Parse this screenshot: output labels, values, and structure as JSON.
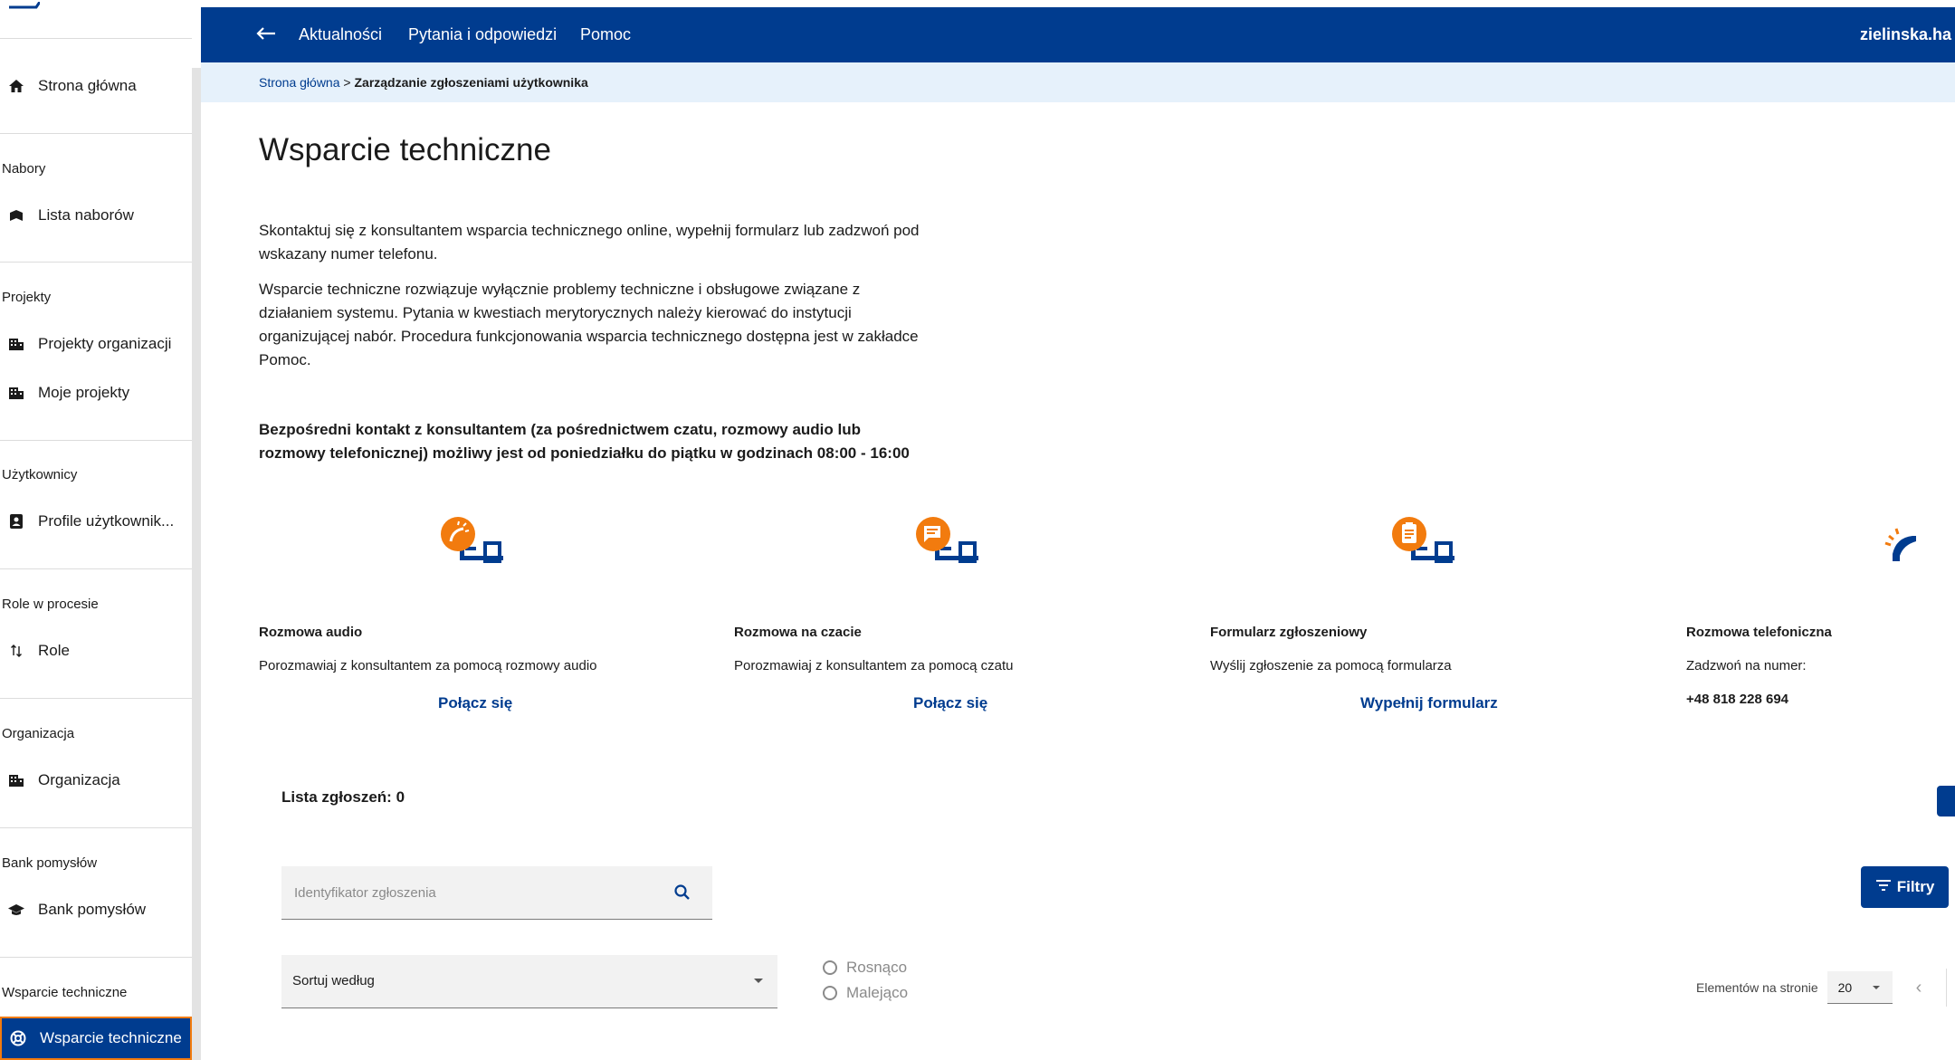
{
  "sidebar": {
    "items": [
      {
        "label": "Strona główna",
        "icon": "home-icon"
      },
      {
        "label": "Lista naborów",
        "icon": "books-icon"
      },
      {
        "label": "Projekty organizacji",
        "icon": "building-icon"
      },
      {
        "label": "Moje projekty",
        "icon": "building-icon"
      },
      {
        "label": "Profile użytkownik...",
        "icon": "contact-card-icon"
      },
      {
        "label": "Role",
        "icon": "sort-arrows-icon"
      },
      {
        "label": "Organizacja",
        "icon": "building-icon"
      },
      {
        "label": "Bank pomysłów",
        "icon": "graduation-cap-icon"
      },
      {
        "label": "Wsparcie techniczne",
        "icon": "lifebuoy-icon"
      }
    ],
    "sections": [
      "Nabory",
      "Projekty",
      "Użytkownicy",
      "Role w procesie",
      "Organizacja",
      "Bank pomysłów",
      "Wsparcie techniczne"
    ]
  },
  "topbar": {
    "nav": [
      "Aktualności",
      "Pytania i odpowiedzi",
      "Pomoc"
    ],
    "user": "zielinska.ha"
  },
  "breadcrumb": {
    "home": "Strona główna",
    "separator": ">",
    "current": "Zarządzanie zgłoszeniami użytkownika"
  },
  "page": {
    "title": "Wsparcie techniczne",
    "intro1": "Skontaktuj się z konsultantem wsparcia technicznego online, wypełnij formularz lub zadzwoń pod wskazany numer telefonu.",
    "intro2": "Wsparcie techniczne rozwiązuje wyłącznie problemy techniczne i obsługowe związane z działaniem systemu. Pytania w kwestiach merytorycznych należy kierować do instytucji organizującej nabór. Procedura funkcjonowania wsparcia technicznego dostępna jest w zakładce Pomoc.",
    "hours": "Bezpośredni kontakt z konsultantem (za pośrednictwem czatu, rozmowy audio lub rozmowy telefonicznej) możliwy jest od poniedziałku do piątku w godzinach 08:00 - 16:00"
  },
  "channels": [
    {
      "title": "Rozmowa audio",
      "desc": "Porozmawiaj z konsultantem za pomocą rozmowy audio",
      "link": "Połącz się",
      "icon": "audio-call-icon"
    },
    {
      "title": "Rozmowa na czacie",
      "desc": "Porozmawiaj z konsultantem za pomocą czatu",
      "link": "Połącz się",
      "icon": "chat-icon"
    },
    {
      "title": "Formularz zgłoszeniowy",
      "desc": "Wyślij zgłoszenie za pomocą formularza",
      "link": "Wypełnij formularz",
      "icon": "form-icon"
    },
    {
      "title": "Rozmowa telefoniczna",
      "desc": "Zadzwoń na numer:",
      "link": "+48 818 228 694",
      "icon": "phone-icon"
    }
  ],
  "list": {
    "title": "Lista zgłoszeń: 0",
    "search_placeholder": "Identyfikator zgłoszenia",
    "filters_label": "Filtry",
    "sort_label": "Sortuj według",
    "asc_label": "Rosnąco",
    "desc_label": "Malejąco",
    "per_page_label": "Elementów na stronie",
    "per_page_value": "20"
  },
  "colors": {
    "primary": "#003c8f",
    "accent": "#f27b0e",
    "breadcrumb_bg": "#e6f1fb"
  }
}
